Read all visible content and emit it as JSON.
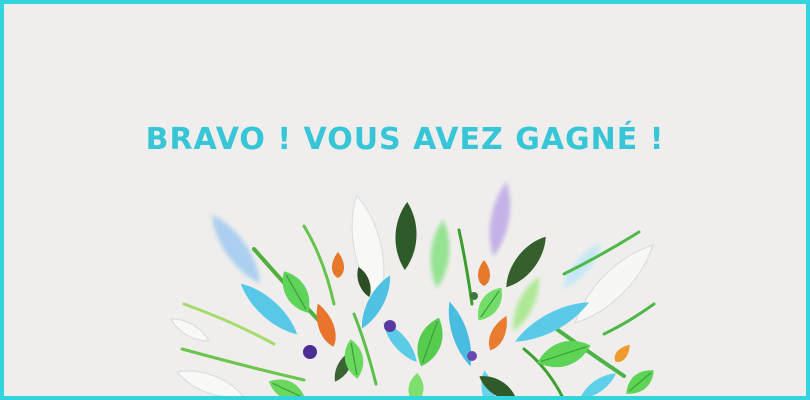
{
  "headline": {
    "text": "BRAVO ! VOUS AVEZ GAGNÉ !"
  },
  "colors": {
    "border": "#33d4dc",
    "background": "#efeeec",
    "headline": "#36c6d8",
    "leaf_light_green": "#5fd35a",
    "leaf_dark_green": "#2f5a2a",
    "leaf_blue": "#57c9e6",
    "leaf_white": "#f6f6f4",
    "berry_purple": "#5a3aa0",
    "drop_orange": "#e6782a"
  },
  "decoration": {
    "name": "leaf-burst-illustration"
  }
}
